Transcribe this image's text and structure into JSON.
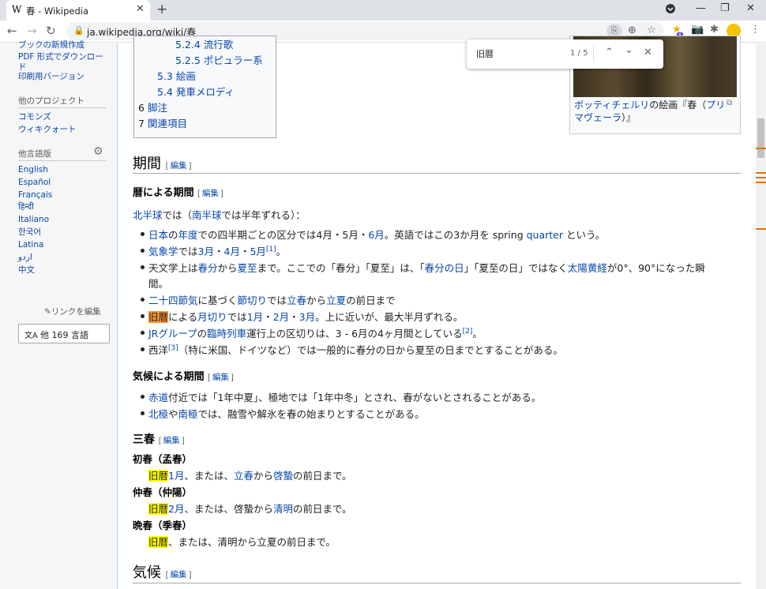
{
  "browser": {
    "tab_title": "春 - Wikipedia",
    "tab_favicon": "W",
    "url": "ja.wikipedia.org/wiki/春",
    "ext_badge": "5"
  },
  "find": {
    "query": "旧暦",
    "count": "1 / 5"
  },
  "sidebar": {
    "tools_cut": "ブックの新規作成",
    "pdf": "PDF 形式でダウンロード",
    "print": "印刷用バージョン",
    "projects_heading": "他のプロジェクト",
    "commons": "コモンズ",
    "wikiquote": "ウィキクォート",
    "languages_heading": "他言語版",
    "languages": [
      "English",
      "Español",
      "Français",
      "हिन्दी",
      "Italiano",
      "한국어",
      "Latina",
      "اردو",
      "中文"
    ],
    "lang_button": "他 169 言語",
    "edit_links": "リンクを編集"
  },
  "toc": {
    "items": [
      {
        "num": "5.2.4",
        "label": "流行歌"
      },
      {
        "num": "5.2.5",
        "label": "ポピュラー系"
      },
      {
        "num": "5.3",
        "label": "絵画"
      },
      {
        "num": "5.4",
        "label": "発車メロディ"
      },
      {
        "num": "6",
        "label": "脚注"
      },
      {
        "num": "7",
        "label": "関連項目"
      }
    ]
  },
  "thumb": {
    "caption_link": "ボッティチェルリ",
    "caption_rest": "の絵画『春（",
    "caption_link2": "プリマヴェーラ",
    "caption_end": "）』"
  },
  "article": {
    "edit": "編集",
    "h_period": "期間",
    "h_calendar": "暦による期間",
    "north_intro_a": "北半球",
    "north_intro_b": "では（",
    "north_intro_c": "南半球",
    "north_intro_d": "では半年ずれる）：",
    "b1": {
      "a": "日本",
      "b": "の",
      "c": "年度",
      "d": "での四半期ごとの区分では4月・5月・",
      "e": "6月",
      "f": "。英語ではこの3か月を spring ",
      "g": "quarter",
      "h": " という。"
    },
    "b2": {
      "a": "気象学",
      "b": "では",
      "c": "3月",
      "d": "・",
      "e": "4月",
      "f": "・",
      "g": "5月",
      "sup": "[1]",
      "h": "。"
    },
    "b3": {
      "a": "天文学上は",
      "b": "春分",
      "c": "から",
      "d": "夏至",
      "e": "まで。ここでの「春分」「夏至」は、「",
      "f": "春分の日",
      "g": "」「夏至の日」ではなく",
      "h": "太陽黄経",
      "i": "が0°、90°になった瞬",
      "j": "間。"
    },
    "b4": {
      "a": "二十四節気",
      "b": "に基づく",
      "c": "節切り",
      "d": "では",
      "e": "立春",
      "f": "から",
      "g": "立夏",
      "h": "の前日まで"
    },
    "b5": {
      "a": "旧暦",
      "b": "による",
      "c": "月切り",
      "d": "では",
      "e": "1月",
      "f": "・",
      "g": "2月",
      "h": "・",
      "i": "3月",
      "j": "。上に近いが、最大半月ずれる。"
    },
    "b6": {
      "a": "JRグループ",
      "b": "の",
      "c": "臨時列車",
      "d": "運行上の区切りは、3 - 6月の4ヶ月間としている",
      "sup": "[2]",
      "e": "。"
    },
    "b7": {
      "a": "西洋",
      "sup": "[3]",
      "b": "（特に米国、ドイツなど）では一般的に春分の日から夏至の日までとすることがある。"
    },
    "h_climate": "気候による期間",
    "c1": {
      "a": "赤道",
      "b": "付近では「1年中夏」、極地では「1年中冬」とされ、春がないとされることがある。"
    },
    "c2": {
      "a": "北極",
      "b": "や",
      "c": "南極",
      "d": "では、融雪や解氷を春の始まりとすることがある。"
    },
    "h_three": "三春",
    "s1_term": "初春（孟春）",
    "s1": {
      "a": "旧暦",
      "b": "1月",
      "c": "、または、",
      "d": "立春",
      "e": "から",
      "f": "啓蟄",
      "g": "の前日まで。"
    },
    "s2_term": "仲春（仲陽）",
    "s2": {
      "a": "旧暦",
      "b": "2月",
      "c": "、または、啓蟄から",
      "d": "清明",
      "e": "の前日まで。"
    },
    "s3_term": "晩春（季春）",
    "s3": {
      "a": "旧暦",
      "b": "、または、清明から立夏の前日まで。"
    },
    "h_weather": "気候"
  }
}
